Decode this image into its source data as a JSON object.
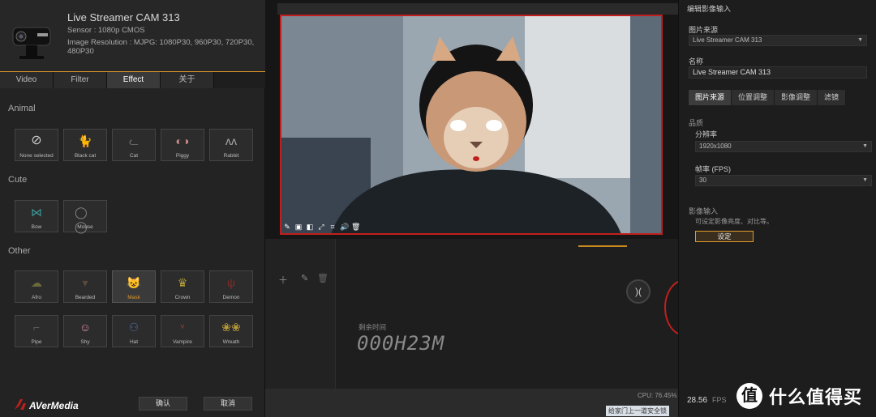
{
  "device": {
    "name": "Live Streamer CAM 313",
    "sensor": "Sensor : 1080p CMOS",
    "resolution": "Image Resolution : MJPG: 1080P30, 960P30, 720P30, 480P30"
  },
  "tabs": [
    {
      "label": "Video"
    },
    {
      "label": "Filter"
    },
    {
      "label": "Effect"
    },
    {
      "label": "关于"
    }
  ],
  "active_tab": "Effect",
  "sections": {
    "animal": "Animal",
    "cute": "Cute",
    "other": "Other"
  },
  "effects": {
    "animal": [
      {
        "label": "None selected",
        "icon": "none-icon"
      },
      {
        "label": "Black cat",
        "icon": "black-cat-icon"
      },
      {
        "label": "Cat",
        "icon": "cat-icon"
      },
      {
        "label": "Piggy",
        "icon": "piggy-icon"
      },
      {
        "label": "Rabbit",
        "icon": "rabbit-icon"
      }
    ],
    "cute": [
      {
        "label": "Bow",
        "icon": "bow-icon"
      },
      {
        "label": "Mouse",
        "icon": "mouse-icon"
      }
    ],
    "other": [
      {
        "label": "Afro",
        "icon": "afro-icon"
      },
      {
        "label": "Bearded",
        "icon": "beard-icon"
      },
      {
        "label": "Mask",
        "icon": "mask-icon"
      },
      {
        "label": "Crown",
        "icon": "crown-icon"
      },
      {
        "label": "Demon",
        "icon": "demon-icon"
      },
      {
        "label": "Pipe",
        "icon": "pipe-icon"
      },
      {
        "label": "Shy",
        "icon": "shy-icon"
      },
      {
        "label": "Hat",
        "icon": "hat-icon"
      },
      {
        "label": "Vampire",
        "icon": "vampire-icon"
      },
      {
        "label": "Wreath",
        "icon": "wreath-icon"
      }
    ]
  },
  "selected_effect": "Mask",
  "footer": {
    "brand": "AVerMedia",
    "confirm": "确认",
    "cancel": "取消"
  },
  "timeline": {
    "remaining_label": "剩余时间",
    "remaining_value": "000H23M",
    "cpu": "CPU: 76.45%",
    "taskbar_msg": "给家门上一道安全锁"
  },
  "right_panel": {
    "title": "编辑影像输入",
    "source_label": "图片来源",
    "source_value": "Live Streamer CAM 313",
    "name_label": "名称",
    "name_value": "Live Streamer CAM 313",
    "tabs": [
      {
        "label": "图片来源"
      },
      {
        "label": "位置调整"
      },
      {
        "label": "影像调整"
      },
      {
        "label": "滤镜"
      }
    ],
    "quality_label": "品质",
    "resolution_label": "分辨率",
    "resolution_value": "1920x1080",
    "framerate_label": "帧率 (FPS)",
    "framerate_value": "30",
    "video_input_label": "影像输入",
    "video_input_desc": "可设定影像亮度、对比等。",
    "settings_button": "设定",
    "fps_value": "28.56",
    "fps_unit": "FPS"
  },
  "watermark": {
    "symbol": "值",
    "text": "什么值得买"
  },
  "colors": {
    "accent": "#e39a2a",
    "preview_border": "#c0201d"
  }
}
